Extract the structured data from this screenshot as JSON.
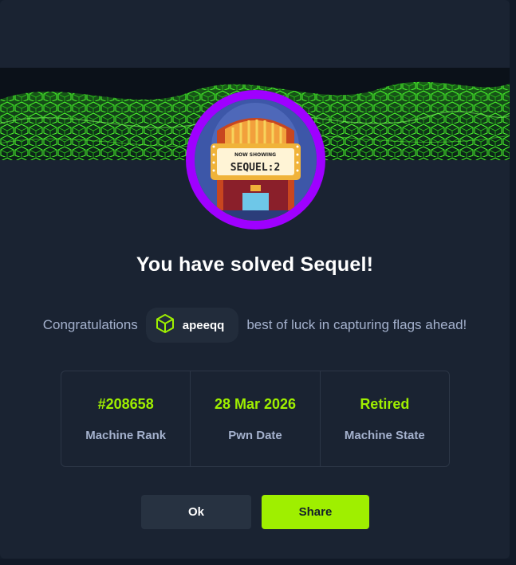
{
  "modal": {
    "title": "You have solved Sequel!",
    "congrats_prefix": "Congratulations",
    "username": "apeeqq",
    "congrats_suffix": "best of luck in capturing flags ahead!",
    "avatar_marquee_top": "NOW SHOWING",
    "avatar_marquee_main": "SEQUEL:2",
    "stats": [
      {
        "value": "#208658",
        "label": "Machine Rank"
      },
      {
        "value": "28 Mar 2026",
        "label": "Pwn Date"
      },
      {
        "value": "Retired",
        "label": "Machine State"
      }
    ],
    "buttons": {
      "ok_label": "Ok",
      "share_label": "Share"
    }
  },
  "colors": {
    "background": "#141d2b",
    "panel": "#1a2332",
    "accent_green": "#9fef00",
    "avatar_ring": "#9f00ff",
    "muted_text": "#a4b1cd"
  },
  "icons": {
    "user_badge": "cube-icon"
  }
}
